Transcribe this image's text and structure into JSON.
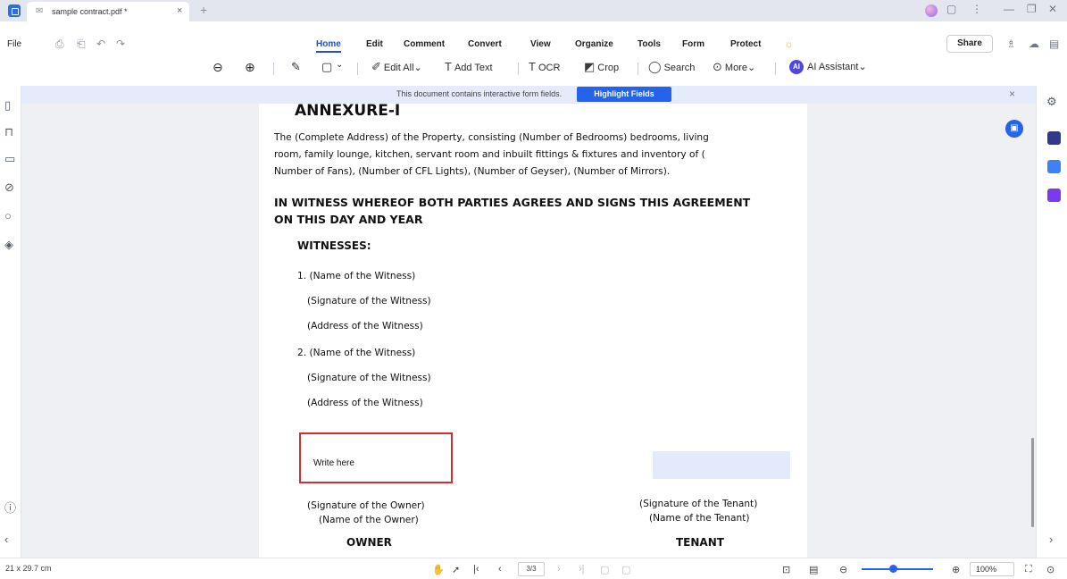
{
  "titlebar": {
    "tab_icon": "✉",
    "tab_title": "sample contract.pdf *",
    "tab_close": "×",
    "new_tab": "+",
    "icons": [
      "avatar",
      "panel-icon",
      "more-icon",
      "minimize-icon",
      "restore-icon",
      "close-icon"
    ],
    "controls": {
      "panel": "▢",
      "more": "⋮",
      "minimize": "—",
      "restore": "❐",
      "close": "✕"
    }
  },
  "menu": {
    "file": "File",
    "items": [
      "Home",
      "Edit",
      "Comment",
      "Convert",
      "View",
      "Organize",
      "Tools",
      "Form",
      "Protect"
    ],
    "share": "Share",
    "quick": {
      "save": "⎙",
      "print": "⎗",
      "undo": "↶",
      "redo": "↷"
    }
  },
  "toolbar": {
    "zoom_out": "⊖",
    "zoom_in": "⊕",
    "edit_all": "Edit All",
    "add_text": "Add Text",
    "ocr": "OCR",
    "crop": "Crop",
    "search": "Search",
    "more": "More",
    "ai_badge": "AI",
    "ai_assistant": "AI Assistant",
    "caret": "⌄"
  },
  "notice": {
    "text": "This document contains interactive form fields.",
    "button": "Highlight Fields",
    "close": "×"
  },
  "document": {
    "title": "ANNEXURE-I",
    "para_lines": [
      "The (Complete Address) of the Property, consisting (Number of Bedrooms) bedrooms, living",
      "room, family lounge, kitchen, servant room and inbuilt fittings & fixtures and inventory of (",
      "Number of Fans), (Number of CFL Lights), (Number of Geyser), (Number of Mirrors)."
    ],
    "witness_heading_lines": [
      "IN WITNESS WHEREOF BOTH PARTIES AGREES AND SIGNS THIS AGREEMENT",
      "ON THIS DAY AND YEAR"
    ],
    "witnesses_label": "WITNESSES:",
    "witness1": [
      "1. (Name of the Witness)",
      "(Signature of the Witness)",
      "(Address of the Witness)"
    ],
    "witness2": [
      "2. (Name of the Witness)",
      "(Signature of the Witness)",
      "(Address of the Witness)"
    ],
    "owner_field_value": "Write here",
    "owner_sig": "(Signature of the Owner)",
    "owner_name": "(Name of the Owner)",
    "owner_label": "OWNER",
    "tenant_sig": "(Signature of the Tenant)",
    "tenant_name": "(Name of the Tenant)",
    "tenant_label": "TENANT"
  },
  "status": {
    "page_size": "21 x 29.7 cm",
    "page_indicator": "3/3",
    "zoom": "100%",
    "zoom_fraction": 0.4
  }
}
